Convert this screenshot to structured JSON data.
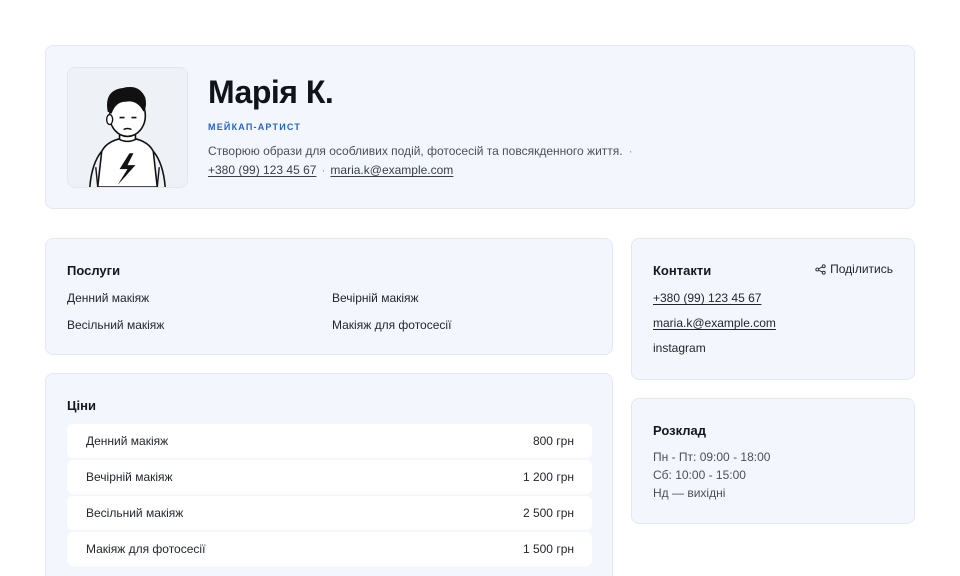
{
  "profile": {
    "name": "Марія К.",
    "role": "Мейкап-артист",
    "bio": "Створюю образи для особливих подій, фотосесій та повсякденного життя.",
    "bio_separator": "·",
    "phone": "+380 (99) 123 45 67",
    "separator": "·",
    "email": "maria.k@example.com"
  },
  "services": {
    "title": "Послуги",
    "items": [
      "Денний макіяж",
      "Вечірній макіяж",
      "Весільний макіяж",
      "Макіяж для фотосесії"
    ]
  },
  "prices": {
    "title": "Ціни",
    "rows": [
      {
        "name": "Денний макіяж",
        "price": "800 грн"
      },
      {
        "name": "Вечірній макіяж",
        "price": "1 200 грн"
      },
      {
        "name": "Весільний макіяж",
        "price": "2 500 грн"
      },
      {
        "name": "Макіяж для фотосесії",
        "price": "1 500 грн"
      }
    ]
  },
  "contacts": {
    "title": "Контакти",
    "share_label": "Поділитись",
    "share_icon": "share-icon",
    "phone": "+380 (99) 123 45 67",
    "email": "maria.k@example.com",
    "instagram": "instagram"
  },
  "schedule": {
    "title": "Розклад",
    "lines": [
      "Пн - Пт: 09:00 - 18:00",
      "Сб: 10:00 - 15:00",
      "Нд — вихідні"
    ]
  },
  "colors": {
    "accent": "#2563c9",
    "card_bg": "#f3f6fd",
    "card_border": "#e3e8f3"
  }
}
